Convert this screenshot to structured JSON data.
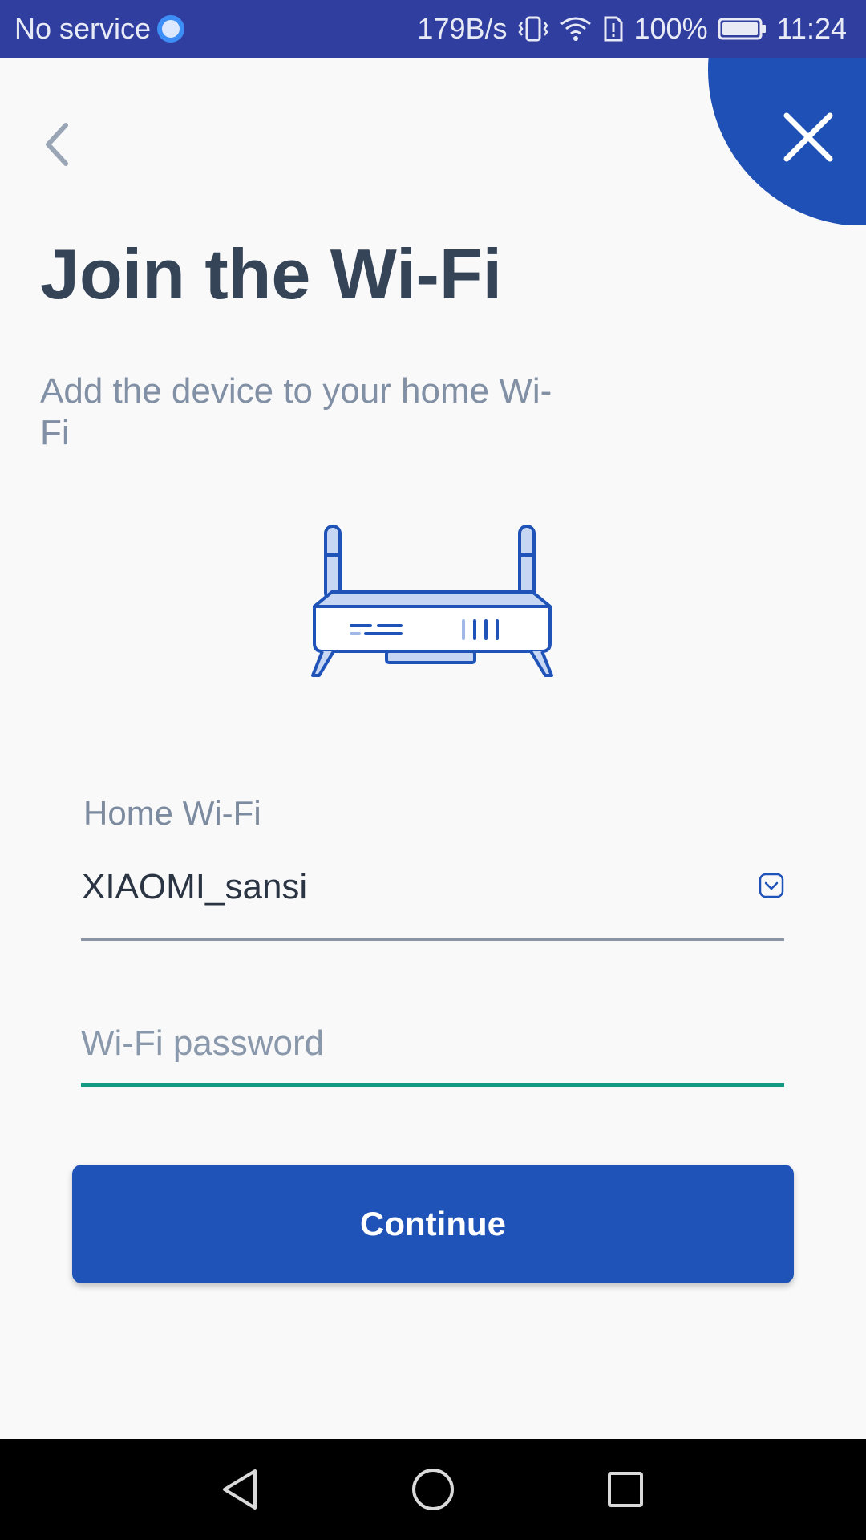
{
  "status_bar": {
    "carrier": "No service",
    "net_speed": "179B/s",
    "battery": "100%",
    "time": "11:24"
  },
  "header": {
    "title": "Join the Wi-Fi",
    "subtitle": "Add the device to your home Wi-Fi"
  },
  "form": {
    "wifi_label": "Home Wi-Fi",
    "wifi_value": "XIAOMI_sansi",
    "password_placeholder": "Wi-Fi password",
    "password_value": ""
  },
  "actions": {
    "continue_label": "Continue"
  },
  "icons": {
    "back": "chevron-left-icon",
    "close": "close-icon",
    "dropdown": "chevron-down-icon",
    "illustration": "router-icon"
  },
  "colors": {
    "status_bar": "#303f9f",
    "primary": "#1f53b7",
    "title": "#364458",
    "focus_underline": "#139883"
  }
}
